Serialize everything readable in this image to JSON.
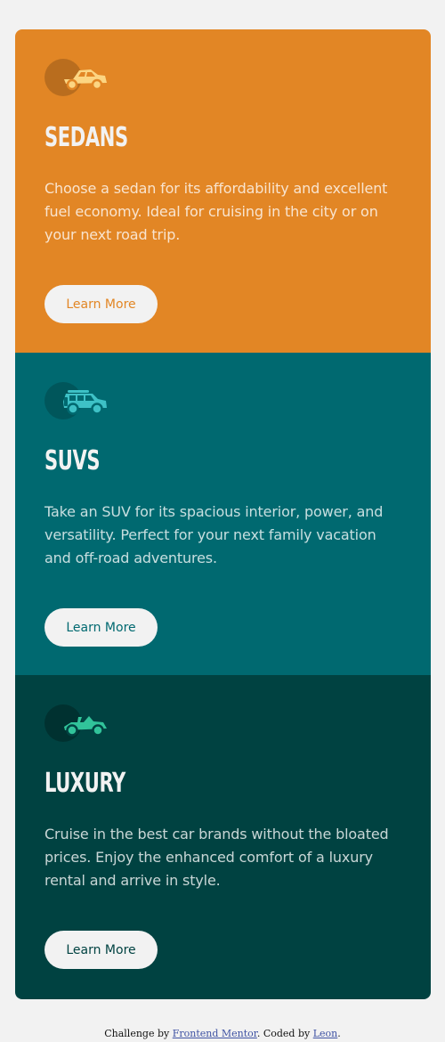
{
  "colors": {
    "sedans": "#e28625",
    "suvs": "#006970",
    "luxury": "#004241",
    "light": "#f2f2f2"
  },
  "cards": [
    {
      "icon": "sedan-car-icon",
      "title": "SEDANS",
      "description": "Choose a sedan for its affordability and excellent fuel economy. Ideal for cruising in the city or on your next road trip.",
      "button": "Learn More"
    },
    {
      "icon": "suv-car-icon",
      "title": "SUVS",
      "description": "Take an SUV for its spacious interior, power, and versatility. Perfect for your next family vacation and off-road adventures.",
      "button": "Learn More"
    },
    {
      "icon": "luxury-car-icon",
      "title": "LUXURY",
      "description": "Cruise in the best car brands without the bloated prices. Enjoy the enhanced comfort of a luxury rental and arrive in style.",
      "button": "Learn More"
    }
  ],
  "attribution": {
    "prefix": "Challenge by ",
    "link1": "Frontend Mentor",
    "middle": ". Coded by ",
    "link2": "Leon",
    "suffix": "."
  }
}
